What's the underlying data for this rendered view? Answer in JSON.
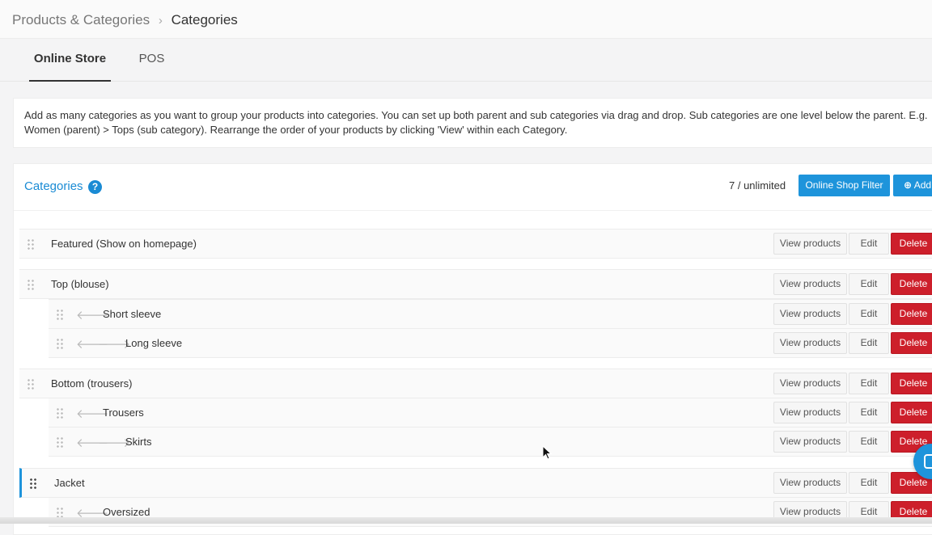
{
  "breadcrumb": {
    "parent": "Products & Categories",
    "separator": "›",
    "current": "Categories"
  },
  "tabs": [
    {
      "label": "Online Store",
      "active": true
    },
    {
      "label": "POS",
      "active": false
    }
  ],
  "info": {
    "line1": "Add as many categories as you want to group your products into categories. You can set up both parent and sub categories via drag and drop. Sub categories are one level below the parent. E.g.",
    "line2": "Women (parent) > Tops (sub category). Rearrange the order of your products by clicking 'View' within each Category."
  },
  "categories_panel": {
    "title": "Categories",
    "help_icon": "?",
    "count": "7 / unlimited",
    "filter_button": "Online Shop Filter",
    "add_button": "Add",
    "add_icon": "⊕"
  },
  "row_buttons": {
    "view": "View products",
    "edit": "Edit",
    "delete": "Delete"
  },
  "rows": [
    {
      "name": "Featured (Show on homepage)"
    },
    {
      "name": "Top (blouse)"
    },
    {
      "name": "Short sleeve"
    },
    {
      "name": "Long sleeve"
    },
    {
      "name": "Bottom (trousers)"
    },
    {
      "name": "Trousers"
    },
    {
      "name": "Skirts"
    },
    {
      "name": "Jacket"
    },
    {
      "name": "Oversized"
    }
  ],
  "colors": {
    "accent": "#1e94db",
    "danger": "#cd1f2b",
    "title": "#1a8bd4"
  }
}
